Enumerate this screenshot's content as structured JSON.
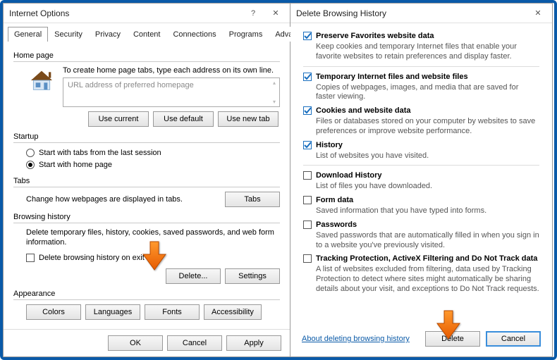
{
  "left": {
    "title": "Internet Options",
    "help_glyph": "?",
    "close_glyph": "✕",
    "tabs": [
      "General",
      "Security",
      "Privacy",
      "Content",
      "Connections",
      "Programs",
      "Advanced"
    ],
    "active_tab": "General",
    "homepage": {
      "label": "Home page",
      "hint": "To create home page tabs, type each address on its own line.",
      "placeholder": "URL address of preferred homepage",
      "btn_use_current": "Use current",
      "btn_use_default": "Use default",
      "btn_use_new_tab": "Use new tab"
    },
    "startup": {
      "label": "Startup",
      "opt_last_session": "Start with tabs from the last session",
      "opt_home_page": "Start with home page"
    },
    "tabs_section": {
      "label": "Tabs",
      "desc": "Change how webpages are displayed in tabs.",
      "btn_tabs": "Tabs"
    },
    "history": {
      "label": "Browsing history",
      "desc": "Delete temporary files, history, cookies, saved passwords, and web form information.",
      "chk_delete_on_exit": "Delete browsing history on exit",
      "btn_delete": "Delete...",
      "btn_settings": "Settings"
    },
    "appearance": {
      "label": "Appearance",
      "btn_colors": "Colors",
      "btn_languages": "Languages",
      "btn_fonts": "Fonts",
      "btn_accessibility": "Accessibility"
    },
    "footer": {
      "ok": "OK",
      "cancel": "Cancel",
      "apply": "Apply"
    }
  },
  "right": {
    "title": "Delete Browsing History",
    "close_glyph": "✕",
    "options": [
      {
        "checked": true,
        "label": "Preserve Favorites website data",
        "desc": "Keep cookies and temporary Internet files that enable your favorite websites to retain preferences and display faster."
      },
      {
        "checked": true,
        "label": "Temporary Internet files and website files",
        "desc": "Copies of webpages, images, and media that are saved for faster viewing."
      },
      {
        "checked": true,
        "label": "Cookies and website data",
        "desc": "Files or databases stored on your computer by websites to save preferences or improve website performance."
      },
      {
        "checked": true,
        "label": "History",
        "desc": "List of websites you have visited."
      },
      {
        "checked": false,
        "label": "Download History",
        "desc": "List of files you have downloaded."
      },
      {
        "checked": false,
        "label": "Form data",
        "desc": "Saved information that you have typed into forms."
      },
      {
        "checked": false,
        "label": "Passwords",
        "desc": "Saved passwords that are automatically filled in when you sign in to a website you've previously visited."
      },
      {
        "checked": false,
        "label": "Tracking Protection, ActiveX Filtering and Do Not Track data",
        "desc": "A list of websites excluded from filtering, data used by Tracking Protection to detect where sites might automatically be sharing details about your visit, and exceptions to Do Not Track requests."
      }
    ],
    "link": "About deleting browsing history",
    "btn_delete": "Delete",
    "btn_cancel": "Cancel"
  }
}
